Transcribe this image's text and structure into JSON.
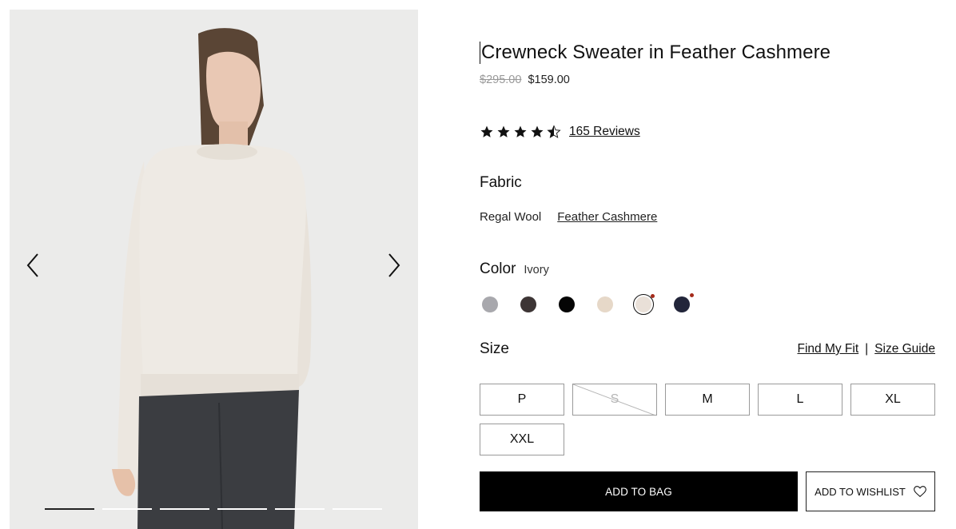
{
  "product": {
    "title": "Crewneck Sweater in Feather Cashmere",
    "original_price": "$295.00",
    "sale_price": "$159.00"
  },
  "rating": {
    "stars": 4.5,
    "reviews_label": "165 Reviews"
  },
  "fabric": {
    "label": "Fabric",
    "options": [
      "Regal Wool",
      "Feather Cashmere"
    ],
    "selected": "Feather Cashmere"
  },
  "color": {
    "label": "Color",
    "selected_name": "Ivory",
    "swatches": [
      {
        "color": "#a8a8ad",
        "selected": false,
        "badge": false
      },
      {
        "color": "#3d3535",
        "selected": false,
        "badge": false
      },
      {
        "color": "#050505",
        "selected": false,
        "badge": false
      },
      {
        "color": "#e6d8c8",
        "selected": false,
        "badge": false
      },
      {
        "color": "#e9e0d8",
        "selected": true,
        "badge": true
      },
      {
        "color": "#22253a",
        "selected": false,
        "badge": true
      }
    ],
    "badge_color": "#a52a1a"
  },
  "size": {
    "label": "Size",
    "find_fit_label": "Find My Fit",
    "separator": "|",
    "size_guide_label": "Size Guide",
    "options": [
      {
        "label": "P",
        "available": true
      },
      {
        "label": "S",
        "available": false
      },
      {
        "label": "M",
        "available": true
      },
      {
        "label": "L",
        "available": true
      },
      {
        "label": "XL",
        "available": true
      },
      {
        "label": "XXL",
        "available": true
      }
    ]
  },
  "actions": {
    "add_to_bag": "ADD TO BAG",
    "add_to_wishlist": "ADD TO WISHLIST"
  },
  "gallery": {
    "image_count": 6,
    "active_index": 0
  }
}
